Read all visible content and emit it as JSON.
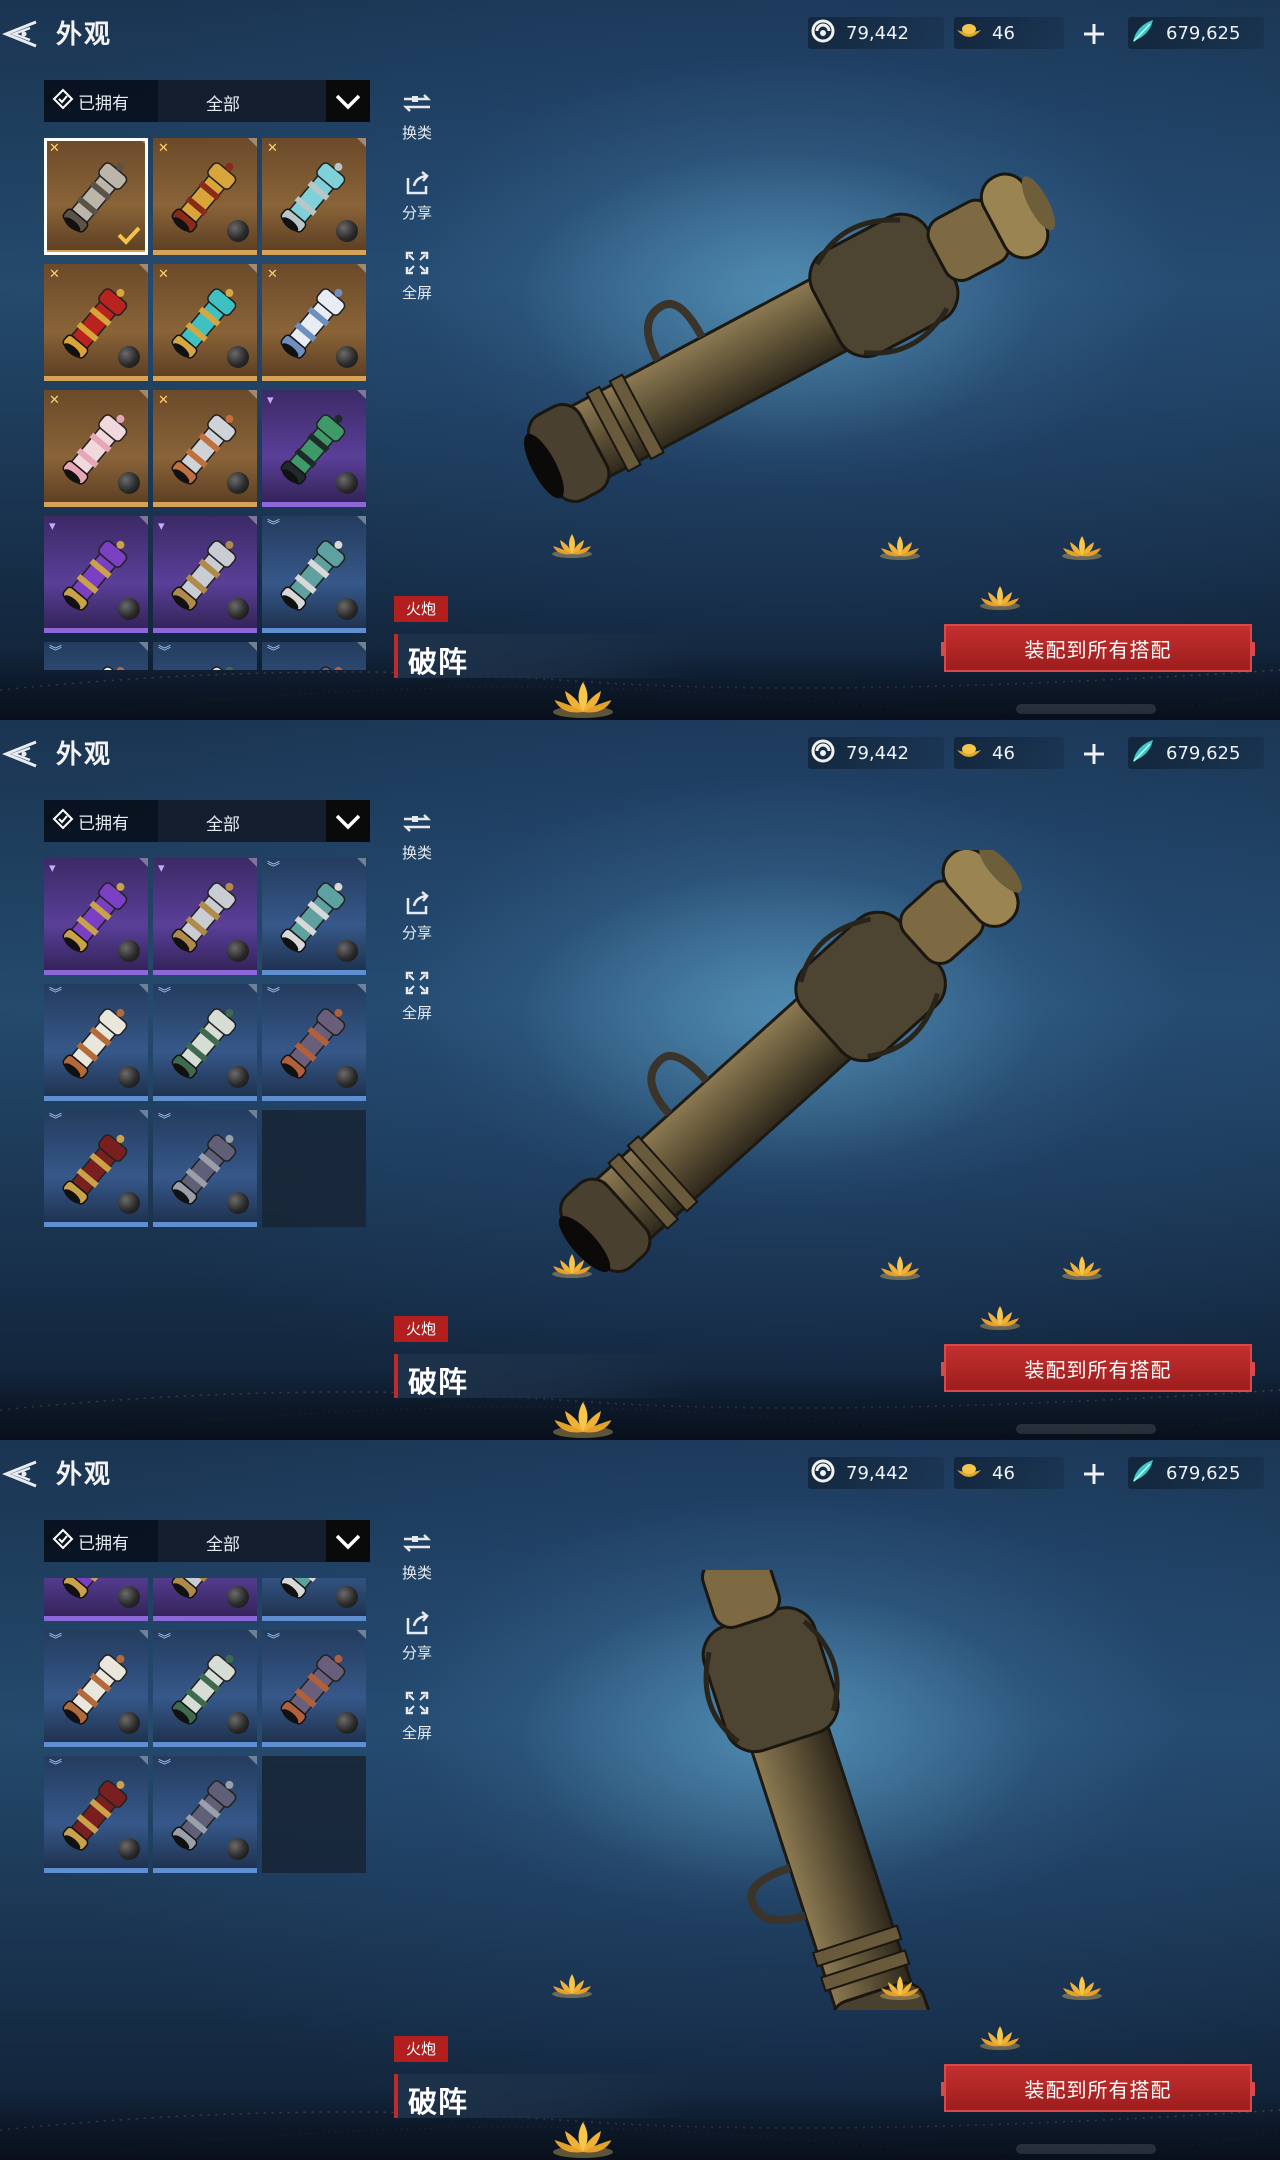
{
  "header": {
    "title": "外观",
    "currencies": [
      {
        "icon": "spirit-coin-icon",
        "value": "79,442"
      },
      {
        "icon": "gold-ingot-icon",
        "value": "46"
      },
      {
        "icon": "jade-feather-icon",
        "value": "679,625"
      }
    ]
  },
  "filter": {
    "owned_label": "已拥有",
    "selected": "全部"
  },
  "tools": [
    {
      "label": "换类",
      "icon": "switch-category-icon"
    },
    {
      "label": "分享",
      "icon": "share-icon"
    },
    {
      "label": "全屏",
      "icon": "fullscreen-icon"
    }
  ],
  "item": {
    "type": "火炮",
    "name": "破阵"
  },
  "equip_label": "装配到所有搭配",
  "colors": {
    "accent_red": "#b31f1f",
    "gold": "#d6a257",
    "purple": "#8b67d8",
    "blue": "#5f8fd0"
  },
  "skins": [
    {
      "rarity": "gold",
      "tint": "#bcb6aa",
      "band": "#5b5348",
      "selected": true,
      "equipped": true
    },
    {
      "rarity": "gold",
      "tint": "#d9a53a",
      "band": "#8a2a1a"
    },
    {
      "rarity": "gold",
      "tint": "#7fd0d8",
      "band": "#b8c6c8"
    },
    {
      "rarity": "gold",
      "tint": "#b8231f",
      "band": "#d9a53a"
    },
    {
      "rarity": "gold",
      "tint": "#3fc1c2",
      "band": "#d3a843"
    },
    {
      "rarity": "gold",
      "tint": "#e8ecf4",
      "band": "#6f8fbd"
    },
    {
      "rarity": "gold",
      "tint": "#f1d8dd",
      "band": "#e7a6b4"
    },
    {
      "rarity": "gold",
      "tint": "#cfd2d6",
      "band": "#c1703d"
    },
    {
      "rarity": "purple",
      "tint": "#3f9a6a",
      "band": "#1f2a2a"
    },
    {
      "rarity": "purple",
      "tint": "#7b3fc4",
      "band": "#c9a24a"
    },
    {
      "rarity": "purple",
      "tint": "#c9ccd2",
      "band": "#b08a4a"
    },
    {
      "rarity": "blue",
      "tint": "#5fa0a0",
      "band": "#d8d8d8"
    },
    {
      "rarity": "blue",
      "tint": "#e9e6dc",
      "band": "#b26a3a"
    },
    {
      "rarity": "blue",
      "tint": "#d5ddd5",
      "band": "#3f6a4f"
    },
    {
      "rarity": "blue",
      "tint": "#6a5f7a",
      "band": "#b0603a"
    },
    {
      "rarity": "blue",
      "tint": "#7a1f1f",
      "band": "#c9a24a"
    },
    {
      "rarity": "blue",
      "tint": "#5f5f78",
      "band": "#9aa0aa"
    }
  ],
  "views": [
    {
      "cannon_angle": -28
    },
    {
      "cannon_angle": -42
    },
    {
      "cannon_angle": -108
    }
  ]
}
